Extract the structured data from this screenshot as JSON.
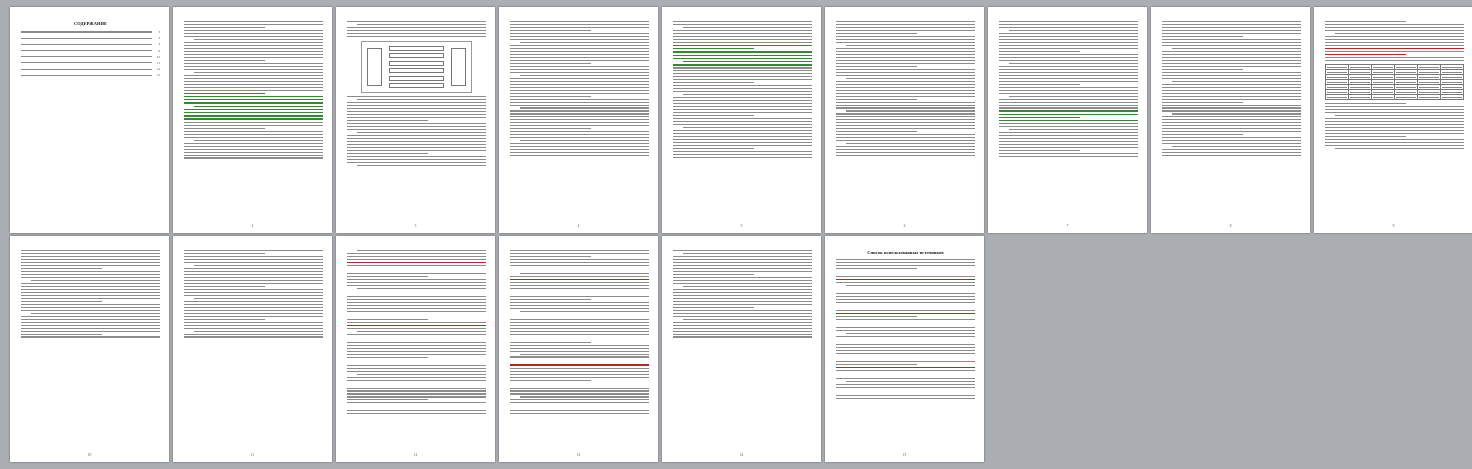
{
  "document": {
    "view": "multi-page thumbnail view",
    "pages": [
      {
        "index": 1,
        "title": "СОДЕРЖАНИЕ",
        "number": "",
        "kind": "toc"
      },
      {
        "index": 2,
        "title": "",
        "number": "2",
        "kind": "text"
      },
      {
        "index": 3,
        "title": "",
        "number": "3",
        "kind": "figure"
      },
      {
        "index": 4,
        "title": "",
        "number": "4",
        "kind": "text"
      },
      {
        "index": 5,
        "title": "",
        "number": "5",
        "kind": "text"
      },
      {
        "index": 6,
        "title": "",
        "number": "6",
        "kind": "text"
      },
      {
        "index": 7,
        "title": "",
        "number": "7",
        "kind": "text"
      },
      {
        "index": 8,
        "title": "",
        "number": "8",
        "kind": "text"
      },
      {
        "index": 9,
        "title": "",
        "number": "9",
        "kind": "table"
      },
      {
        "index": 10,
        "title": "",
        "number": "10",
        "kind": "text"
      },
      {
        "index": 11,
        "title": "",
        "number": "11",
        "kind": "text"
      },
      {
        "index": 12,
        "title": "",
        "number": "12",
        "kind": "list"
      },
      {
        "index": 13,
        "title": "",
        "number": "13",
        "kind": "list"
      },
      {
        "index": 14,
        "title": "",
        "number": "14",
        "kind": "text"
      },
      {
        "index": 15,
        "title": "Список использованных источников",
        "number": "15",
        "kind": "refs"
      }
    ],
    "toc_numbers": [
      "3",
      "3",
      "4",
      "6",
      "10",
      "11",
      "14",
      "15"
    ]
  }
}
